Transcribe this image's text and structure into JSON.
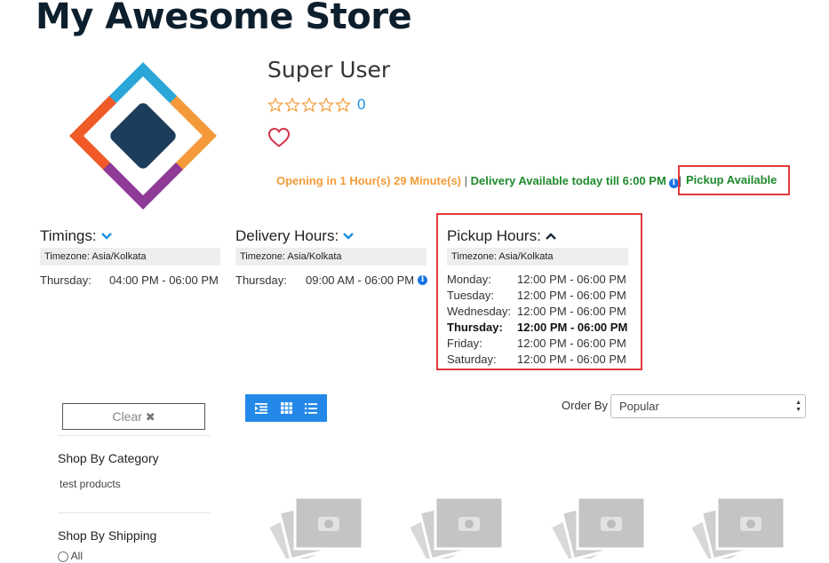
{
  "store": {
    "title": "My Awesome Store",
    "name": "Super User",
    "rating_count": "0",
    "status": {
      "opening": "Opening in 1 Hour(s) 29 Minute(s)",
      "separator": "|",
      "delivery": "Delivery Available today till 6:00 PM",
      "pickup": "Pickup Available"
    },
    "logo_colors": [
      "#2aa7d8",
      "#f05a28",
      "#f49a3a",
      "#8e3a96",
      "#1d3d5c"
    ]
  },
  "timings": {
    "title": "Timings:",
    "timezone": "Timezone: Asia/Kolkata",
    "rows": [
      {
        "day": "Thursday:",
        "hours": "04:00 PM - 06:00 PM"
      }
    ]
  },
  "delivery_hours": {
    "title": "Delivery Hours:",
    "timezone": "Timezone: Asia/Kolkata",
    "rows": [
      {
        "day": "Thursday:",
        "hours": "09:00 AM - 06:00 PM"
      }
    ]
  },
  "pickup_hours": {
    "title": "Pickup Hours:",
    "timezone": "Timezone: Asia/Kolkata",
    "rows": [
      {
        "day": "Monday:",
        "hours": "12:00 PM - 06:00 PM"
      },
      {
        "day": "Tuesday:",
        "hours": "12:00 PM - 06:00 PM"
      },
      {
        "day": "Wednesday:",
        "hours": "12:00 PM - 06:00 PM"
      },
      {
        "day": "Thursday:",
        "hours": "12:00 PM - 06:00 PM"
      },
      {
        "day": "Friday:",
        "hours": "12:00 PM - 06:00 PM"
      },
      {
        "day": "Saturday:",
        "hours": "12:00 PM - 06:00 PM"
      }
    ]
  },
  "toolbar": {
    "order_by_label": "Order By",
    "order_by_value": "Popular"
  },
  "sidebar": {
    "clear_label": "Clear",
    "category_heading": "Shop By Category",
    "categories": [
      "test products"
    ],
    "shipping_heading": "Shop By Shipping",
    "shipping_options": [
      "All"
    ]
  },
  "colors": {
    "accent_blue": "#2388e8",
    "highlight_red": "#e23a3a",
    "status_orange": "#f29c38",
    "status_green": "#1f8a2d"
  }
}
